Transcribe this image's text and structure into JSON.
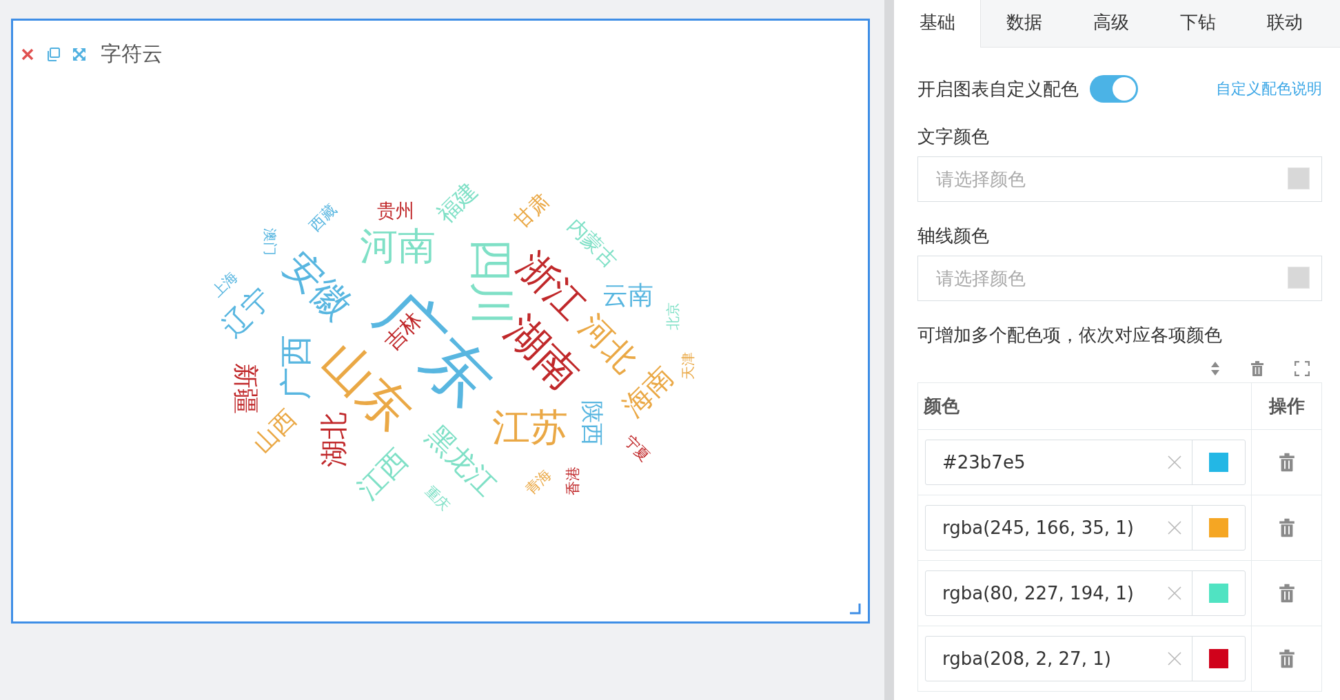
{
  "chart_panel": {
    "title": "字符云",
    "word_cloud": [
      {
        "text": "广东",
        "color": "#58b6e0"
      },
      {
        "text": "山东",
        "color": "#eaa845"
      },
      {
        "text": "四川",
        "color": "#7fe0c6"
      },
      {
        "text": "湖南",
        "color": "#c0282a"
      },
      {
        "text": "浙江",
        "color": "#c0282a"
      },
      {
        "text": "河南",
        "color": "#7fe0c6"
      },
      {
        "text": "安徽",
        "color": "#58b6e0"
      },
      {
        "text": "江苏",
        "color": "#eaa845"
      },
      {
        "text": "河北",
        "color": "#eaa845"
      },
      {
        "text": "广西",
        "color": "#58b6e0"
      },
      {
        "text": "黑龙江",
        "color": "#7fe0c6"
      },
      {
        "text": "江西",
        "color": "#7fe0c6"
      },
      {
        "text": "湖北",
        "color": "#c0282a"
      },
      {
        "text": "海南",
        "color": "#eaa845"
      },
      {
        "text": "山西",
        "color": "#eaa845"
      },
      {
        "text": "新疆",
        "color": "#c0282a"
      },
      {
        "text": "辽宁",
        "color": "#58b6e0"
      },
      {
        "text": "云南",
        "color": "#58b6e0"
      },
      {
        "text": "陕西",
        "color": "#58b6e0"
      },
      {
        "text": "吉林",
        "color": "#c0282a"
      },
      {
        "text": "福建",
        "color": "#7fe0c6"
      },
      {
        "text": "贵州",
        "color": "#c0282a"
      },
      {
        "text": "甘肃",
        "color": "#eaa845"
      },
      {
        "text": "内蒙古",
        "color": "#7fe0c6"
      },
      {
        "text": "西藏",
        "color": "#58b6e0"
      },
      {
        "text": "澳门",
        "color": "#58b6e0"
      },
      {
        "text": "上海",
        "color": "#58b6e0"
      },
      {
        "text": "北京",
        "color": "#7fe0c6"
      },
      {
        "text": "天津",
        "color": "#eaa845"
      },
      {
        "text": "宁夏",
        "color": "#c0282a"
      },
      {
        "text": "香港",
        "color": "#c0282a"
      },
      {
        "text": "青海",
        "color": "#eaa845"
      },
      {
        "text": "重庆",
        "color": "#7fe0c6"
      }
    ]
  },
  "settings_panel": {
    "tabs": [
      {
        "label": "基础",
        "selected": true
      },
      {
        "label": "数据",
        "selected": false
      },
      {
        "label": "高级",
        "selected": false
      },
      {
        "label": "下钻",
        "selected": false
      },
      {
        "label": "联动",
        "selected": false
      }
    ],
    "custom_colors": {
      "label": "开启图表自定义配色",
      "on": true,
      "help_link": "自定义配色说明"
    },
    "text_color": {
      "label": "文字颜色",
      "placeholder": "请选择颜色"
    },
    "axis_color": {
      "label": "轴线颜色",
      "placeholder": "请选择颜色"
    },
    "palette_hint": "可增加多个配色项，依次对应各项颜色",
    "palette_table": {
      "columns": [
        "颜色",
        "操作"
      ],
      "rows": [
        {
          "value": "#23b7e5",
          "color": "#23b7e5"
        },
        {
          "value": "rgba(245, 166, 35, 1)",
          "color": "#f5a623"
        },
        {
          "value": "rgba(80, 227, 194, 1)",
          "color": "#50e3c2"
        },
        {
          "value": "rgba(208, 2, 27, 1)",
          "color": "#d0021b"
        }
      ]
    }
  }
}
